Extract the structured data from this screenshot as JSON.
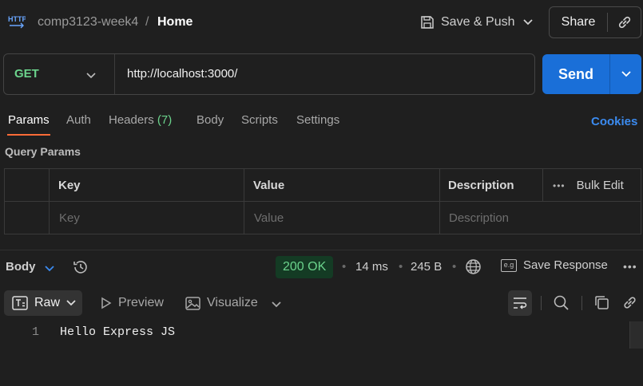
{
  "header": {
    "collection": "comp3123-week4",
    "separator": "/",
    "request_name": "Home",
    "save_push_label": "Save & Push",
    "share_label": "Share"
  },
  "request": {
    "method": "GET",
    "url": "http://localhost:3000/",
    "send_label": "Send"
  },
  "tabs": {
    "params": "Params",
    "auth": "Auth",
    "headers": "Headers",
    "headers_count": "(7)",
    "body": "Body",
    "scripts": "Scripts",
    "settings": "Settings",
    "cookies": "Cookies"
  },
  "query_params": {
    "title": "Query Params",
    "columns": {
      "key": "Key",
      "value": "Value",
      "description": "Description"
    },
    "bulk_edit": "Bulk Edit",
    "placeholders": {
      "key": "Key",
      "value": "Value",
      "description": "Description"
    }
  },
  "response": {
    "body_label": "Body",
    "status": "200 OK",
    "time": "14 ms",
    "size": "245 B",
    "save_response": "Save Response"
  },
  "viewer": {
    "raw": "Raw",
    "preview": "Preview",
    "visualize": "Visualize"
  },
  "content": {
    "line_number": "1",
    "line": "Hello Express JS"
  },
  "colors": {
    "send": "#1a6fd8",
    "method_get": "#6bd38c",
    "status_ok_bg": "#143b24",
    "active_tab_underline": "#ff6c37",
    "cookies_link": "#3b8bf0"
  }
}
